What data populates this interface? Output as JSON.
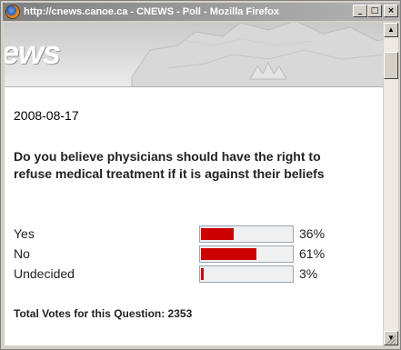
{
  "window": {
    "title": "http://cnews.canoe.ca - CNEWS - Poll - Mozilla Firefox",
    "buttons": {
      "minimize": "_",
      "maximize": "□",
      "close": "×"
    }
  },
  "banner": {
    "logo": "ews"
  },
  "poll": {
    "date": "2008-08-17",
    "question": "Do you believe physicians should have the right to refuse medical treatment if it is against their beliefs",
    "options": [
      {
        "label": "Yes",
        "percent_text": "36%",
        "percent": 36
      },
      {
        "label": "No",
        "percent_text": "61%",
        "percent": 61
      },
      {
        "label": "Undecided",
        "percent_text": "3%",
        "percent": 3
      }
    ],
    "total": "Total Votes for this Question: 2353"
  },
  "colors": {
    "bar": "#cc0000",
    "titlebar": "#808080"
  },
  "icons": {
    "title": "firefox-icon",
    "scroll_up": "arrow-up-icon",
    "scroll_down": "arrow-down-icon"
  }
}
